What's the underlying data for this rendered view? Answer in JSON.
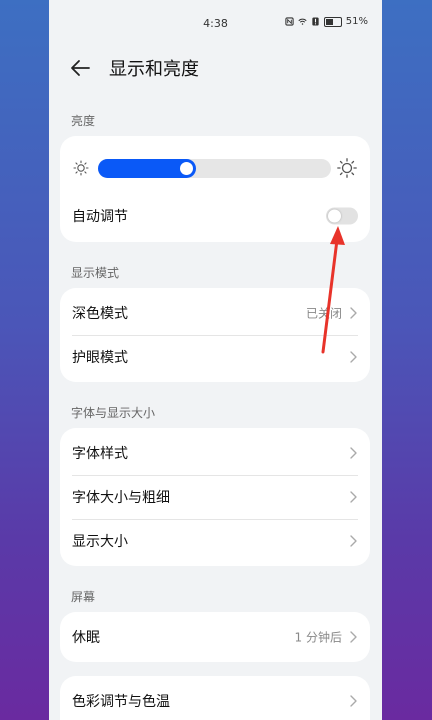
{
  "colors": {
    "accent": "#0a59f7",
    "annotation": "#e8332a"
  },
  "status_bar": {
    "time": "4:38",
    "battery": "51%",
    "icons": [
      "nfc-icon",
      "wifi-icon",
      "notification-icon",
      "battery-icon"
    ]
  },
  "header": {
    "title": "显示和亮度",
    "back_icon": "back-arrow-icon"
  },
  "brightness": {
    "section_label": "亮度",
    "level_fraction": 0.42,
    "auto_label": "自动调节",
    "auto_enabled": false
  },
  "display_mode": {
    "section_label": "显示模式",
    "items": [
      {
        "label": "深色模式",
        "value": "已关闭"
      },
      {
        "label": "护眼模式",
        "value": ""
      }
    ]
  },
  "font": {
    "section_label": "字体与显示大小",
    "items": [
      {
        "label": "字体样式"
      },
      {
        "label": "字体大小与粗细"
      },
      {
        "label": "显示大小"
      }
    ]
  },
  "screen": {
    "section_label": "屏幕",
    "items": [
      {
        "label": "休眠",
        "value": "1 分钟后"
      }
    ]
  },
  "color": {
    "items": [
      {
        "label": "色彩调节与色温"
      }
    ]
  }
}
